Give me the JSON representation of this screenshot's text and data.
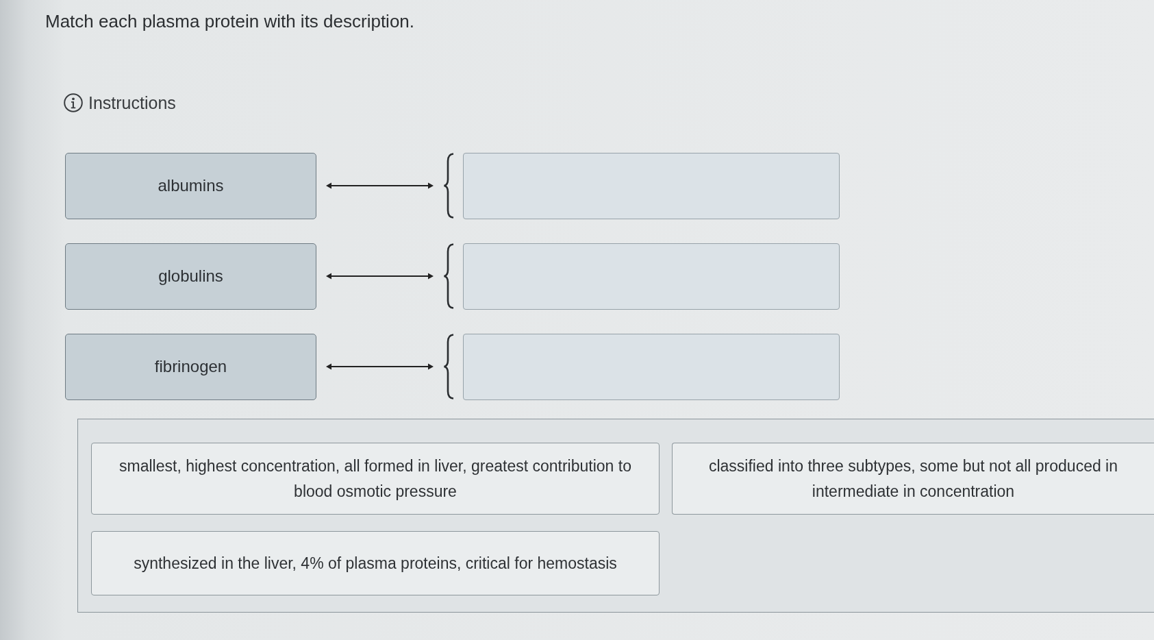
{
  "question": {
    "prompt": "Match each plasma protein with its description.",
    "instructions_label": "Instructions"
  },
  "pairs": [
    {
      "term": "albumins"
    },
    {
      "term": "globulins"
    },
    {
      "term": "fibrinogen"
    }
  ],
  "answer_bank": [
    {
      "text": "smallest, highest concentration, all formed in liver, greatest contribution to blood osmotic pressure"
    },
    {
      "text": "classified into three subtypes, some but not all produced in\nintermediate in concentration"
    },
    {
      "text": "synthesized in the liver, 4% of plasma proteins, critical for hemostasis"
    }
  ]
}
